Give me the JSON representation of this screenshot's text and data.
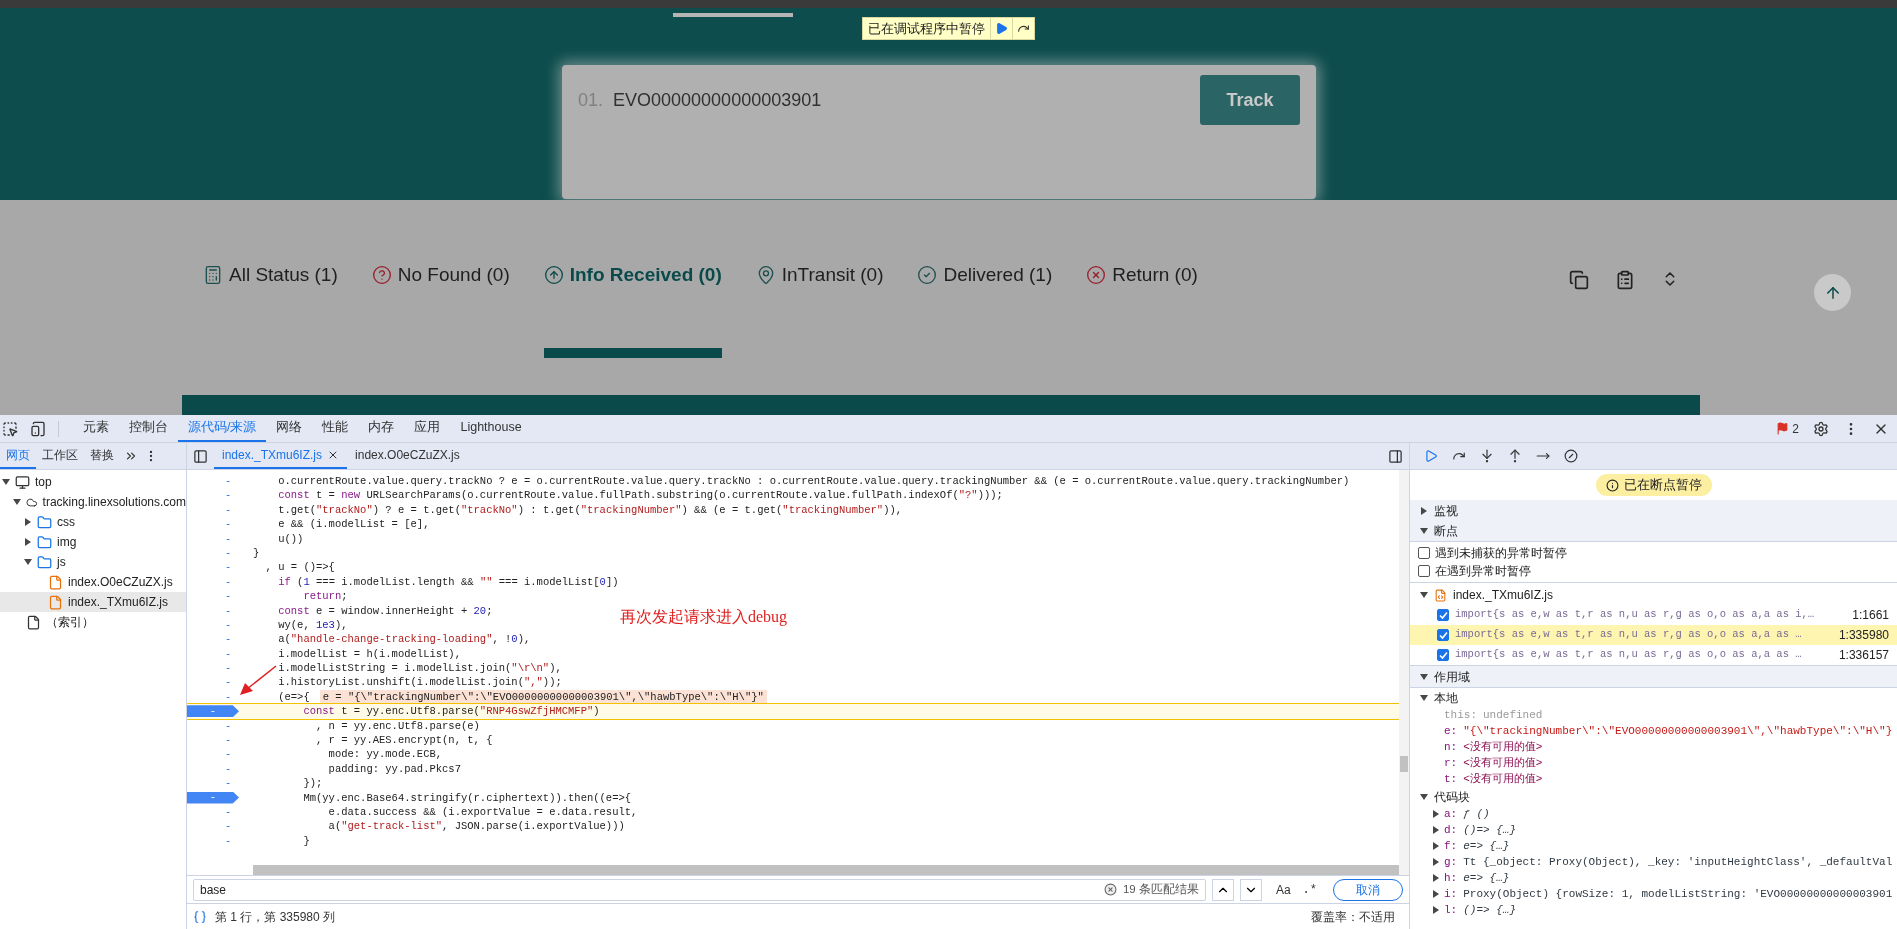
{
  "page": {
    "debugger_banner": {
      "text": "已在调试程序中暂停"
    },
    "search_card": {
      "index": "01.",
      "value": "EVO00000000000003901",
      "button": "Track"
    },
    "status_tabs": [
      {
        "kind": "all",
        "label": "All Status (1)",
        "selected": false
      },
      {
        "kind": "nofound",
        "label": "No Found (0)",
        "selected": false
      },
      {
        "kind": "received",
        "label": "Info Received (0)",
        "selected": true
      },
      {
        "kind": "transit",
        "label": "InTransit (0)",
        "selected": false
      },
      {
        "kind": "delivered",
        "label": "Delivered (1)",
        "selected": false
      },
      {
        "kind": "return",
        "label": "Return (0)",
        "selected": false
      }
    ]
  },
  "devtools": {
    "panel_tabs": [
      {
        "label": "元素",
        "selected": false
      },
      {
        "label": "控制台",
        "selected": false
      },
      {
        "label": "源代码/来源",
        "selected": true
      },
      {
        "label": "网络",
        "selected": false
      },
      {
        "label": "性能",
        "selected": false
      },
      {
        "label": "内存",
        "selected": false
      },
      {
        "label": "应用",
        "selected": false
      },
      {
        "label": "Lighthouse",
        "selected": false
      }
    ],
    "issues_count": "2",
    "navigator_tabs": [
      {
        "label": "网页",
        "selected": true
      },
      {
        "label": "工作区",
        "selected": false
      },
      {
        "label": "替换",
        "selected": false
      }
    ],
    "tree": [
      {
        "kind": "frame",
        "label": "top",
        "expanded": true,
        "selected": false,
        "children": [
          {
            "kind": "domain",
            "label": "tracking.linexsolutions.com",
            "expanded": true,
            "selected": false,
            "children": [
              {
                "kind": "folder",
                "label": "css",
                "expanded": false,
                "selected": false
              },
              {
                "kind": "folder",
                "label": "img",
                "expanded": false,
                "selected": false
              },
              {
                "kind": "folder",
                "label": "js",
                "expanded": true,
                "selected": false,
                "children": [
                  {
                    "kind": "file",
                    "label": "index.O0eCZuZX.js",
                    "selected": false
                  },
                  {
                    "kind": "file",
                    "label": "index._TXmu6IZ.js",
                    "selected": true
                  }
                ]
              }
            ]
          },
          {
            "kind": "page",
            "label": "（索引）",
            "selected": false
          }
        ]
      }
    ],
    "editor_tabs": [
      {
        "label": "index._TXmu6IZ.js",
        "selected": true
      },
      {
        "label": "index.O0eCZuZX.js",
        "selected": false
      }
    ],
    "code_lines": [
      {
        "breakpoint": false,
        "paused": false,
        "tokens": [
          {
            "kind": "plain",
            "text": "    o.currentRoute.value.query.trackNo ? e = o.currentRoute.value.query.trackNo : o.currentRoute.value.query.trackingNumber && (e = o.currentRoute.value.query.trackingNumber)"
          }
        ]
      },
      {
        "breakpoint": false,
        "paused": false,
        "tokens": [
          {
            "kind": "kw",
            "text": "    const"
          },
          {
            "kind": "plain",
            "text": " t = "
          },
          {
            "kind": "kw",
            "text": "new"
          },
          {
            "kind": "plain",
            "text": " URLSearchParams(o.currentRoute.value.fullPath.substring(o.currentRoute.value.fullPath.indexOf("
          },
          {
            "kind": "str",
            "text": "\"?\""
          },
          {
            "kind": "plain",
            "text": ")));"
          }
        ]
      },
      {
        "breakpoint": false,
        "paused": false,
        "tokens": [
          {
            "kind": "plain",
            "text": "    t.get("
          },
          {
            "kind": "str",
            "text": "\"trackNo\""
          },
          {
            "kind": "plain",
            "text": ") ? e = t.get("
          },
          {
            "kind": "str",
            "text": "\"trackNo\""
          },
          {
            "kind": "plain",
            "text": ") : t.get("
          },
          {
            "kind": "str",
            "text": "\"trackingNumber\""
          },
          {
            "kind": "plain",
            "text": ") && (e = t.get("
          },
          {
            "kind": "str",
            "text": "\"trackingNumber\""
          },
          {
            "kind": "plain",
            "text": ")),"
          }
        ]
      },
      {
        "breakpoint": false,
        "paused": false,
        "tokens": [
          {
            "kind": "plain",
            "text": "    e && (i.modelList = [e],"
          }
        ]
      },
      {
        "breakpoint": false,
        "paused": false,
        "tokens": [
          {
            "kind": "plain",
            "text": "    u())"
          }
        ]
      },
      {
        "breakpoint": false,
        "paused": false,
        "tokens": [
          {
            "kind": "plain",
            "text": "}"
          }
        ]
      },
      {
        "breakpoint": false,
        "paused": false,
        "tokens": [
          {
            "kind": "plain",
            "text": "  , u = ()=>{"
          }
        ]
      },
      {
        "breakpoint": false,
        "paused": false,
        "tokens": [
          {
            "kind": "kw",
            "text": "    if"
          },
          {
            "kind": "plain",
            "text": " ("
          },
          {
            "kind": "num",
            "text": "1"
          },
          {
            "kind": "plain",
            "text": " === i.modelList.length && "
          },
          {
            "kind": "str",
            "text": "\"\""
          },
          {
            "kind": "plain",
            "text": " === i.modelList["
          },
          {
            "kind": "num",
            "text": "0"
          },
          {
            "kind": "plain",
            "text": "])"
          }
        ]
      },
      {
        "breakpoint": false,
        "paused": false,
        "tokens": [
          {
            "kind": "kw",
            "text": "        return"
          },
          {
            "kind": "plain",
            "text": ";"
          }
        ]
      },
      {
        "breakpoint": false,
        "paused": false,
        "tokens": [
          {
            "kind": "kw",
            "text": "    const"
          },
          {
            "kind": "plain",
            "text": " e = window.innerHeight + "
          },
          {
            "kind": "num",
            "text": "20"
          },
          {
            "kind": "plain",
            "text": ";"
          }
        ]
      },
      {
        "breakpoint": false,
        "paused": false,
        "tokens": [
          {
            "kind": "plain",
            "text": "    wy(e, "
          },
          {
            "kind": "num",
            "text": "1e3"
          },
          {
            "kind": "plain",
            "text": "),"
          }
        ]
      },
      {
        "breakpoint": false,
        "paused": false,
        "tokens": [
          {
            "kind": "plain",
            "text": "    a("
          },
          {
            "kind": "str",
            "text": "\"handle-change-tracking-loading\""
          },
          {
            "kind": "plain",
            "text": ", !"
          },
          {
            "kind": "num",
            "text": "0"
          },
          {
            "kind": "plain",
            "text": "),"
          }
        ]
      },
      {
        "breakpoint": false,
        "paused": false,
        "tokens": [
          {
            "kind": "plain",
            "text": "    i.modelList = h(i.modelList),"
          }
        ]
      },
      {
        "breakpoint": false,
        "paused": false,
        "tokens": [
          {
            "kind": "plain",
            "text": "    i.modelListString = i.modelList.join("
          },
          {
            "kind": "str",
            "text": "\"\\r\\n\""
          },
          {
            "kind": "plain",
            "text": "),"
          }
        ]
      },
      {
        "breakpoint": false,
        "paused": false,
        "tokens": [
          {
            "kind": "plain",
            "text": "    i.historyList.unshift(i.modelList.join("
          },
          {
            "kind": "str",
            "text": "\",\""
          },
          {
            "kind": "plain",
            "text": "));"
          }
        ]
      },
      {
        "breakpoint": false,
        "paused": false,
        "tokens": [
          {
            "kind": "plain",
            "text": "    (e=>{"
          }
        ],
        "inline_value": "e = \"{\\\"trackingNumber\\\":\\\"EVO00000000000003901\\\",\\\"hawbType\\\":\\\"H\\\"}\""
      },
      {
        "breakpoint": true,
        "paused": true,
        "tokens": [
          {
            "kind": "kw",
            "text": "        const"
          },
          {
            "kind": "plain",
            "text": " t = yy.enc.Utf8.parse("
          },
          {
            "kind": "str",
            "text": "\"RNP4GswZfjHMCMFP\""
          },
          {
            "kind": "plain",
            "text": ")"
          }
        ]
      },
      {
        "breakpoint": false,
        "paused": false,
        "tokens": [
          {
            "kind": "plain",
            "text": "          , n = yy.enc.Utf8.parse(e)"
          }
        ]
      },
      {
        "breakpoint": false,
        "paused": false,
        "tokens": [
          {
            "kind": "plain",
            "text": "          , r = yy.AES.encrypt(n, t, {"
          }
        ]
      },
      {
        "breakpoint": false,
        "paused": false,
        "tokens": [
          {
            "kind": "plain",
            "text": "            mode: yy.mode.ECB,"
          }
        ]
      },
      {
        "breakpoint": false,
        "paused": false,
        "tokens": [
          {
            "kind": "plain",
            "text": "            padding: yy.pad.Pkcs7"
          }
        ]
      },
      {
        "breakpoint": false,
        "paused": false,
        "tokens": [
          {
            "kind": "plain",
            "text": "        });"
          }
        ]
      },
      {
        "breakpoint": true,
        "paused": false,
        "tokens": [
          {
            "kind": "plain",
            "text": "        Mm(yy.enc.Base64.stringify(r.ciphertext)).then((e=>{"
          }
        ]
      },
      {
        "breakpoint": false,
        "paused": false,
        "tokens": [
          {
            "kind": "plain",
            "text": "            e.data.success && (i.exportValue = e.data.result,"
          }
        ]
      },
      {
        "breakpoint": false,
        "paused": false,
        "tokens": [
          {
            "kind": "plain",
            "text": "            a("
          },
          {
            "kind": "str",
            "text": "\"get-track-list\""
          },
          {
            "kind": "plain",
            "text": ", JSON.parse(i.exportValue)))"
          }
        ]
      },
      {
        "breakpoint": false,
        "paused": false,
        "tokens": [
          {
            "kind": "plain",
            "text": "        }"
          }
        ]
      }
    ],
    "gutter_mark": "-",
    "annotation": "再次发起请求进入debug",
    "search": {
      "value": "base",
      "match_count": "19 条匹配结果",
      "case_button": "Aa",
      "regex_button": ".*",
      "cancel_button": "取消"
    },
    "status_bar": {
      "position": "第 1 行，第 335980 列",
      "coverage": "覆盖率：不适用"
    },
    "debugger": {
      "paused_badge": "已在断点暂停",
      "watch": {
        "label": "监视",
        "expanded": false
      },
      "breakpoints_section": {
        "label": "断点",
        "expanded": true
      },
      "exception_options": [
        {
          "label": "遇到未捕获的异常时暂停",
          "checked": false
        },
        {
          "label": "在遇到异常时暂停",
          "checked": false
        }
      ],
      "breakpoint_file": "index._TXmu6IZ.js",
      "breakpoints": [
        {
          "code": "import{s as e,w as t,r as n,u as r,g as o,o as a,a as i,…",
          "location": "1:1661",
          "checked": true,
          "selected": false
        },
        {
          "code": "import{s as e,w as t,r as n,u as r,g as o,o as a,a as …",
          "location": "1:335980",
          "checked": true,
          "selected": true
        },
        {
          "code": "import{s as e,w as t,r as n,u as r,g as o,o as a,a as …",
          "location": "1:336157",
          "checked": true,
          "selected": false
        }
      ],
      "scope_section": {
        "label": "作用域",
        "expanded": true
      },
      "local": {
        "label": "本地",
        "expanded": true,
        "vars": [
          {
            "name": "this:",
            "value": "undefined",
            "kind": "undefined"
          },
          {
            "name": "e:",
            "value": "\"{\\\"trackingNumber\\\":\\\"EVO00000000000003901\\\",\\\"hawbType\\\":\\\"H\\\"}",
            "kind": "string"
          },
          {
            "name": "n:",
            "value": "<没有可用的值>",
            "kind": "unavailable"
          },
          {
            "name": "r:",
            "value": "<没有可用的值>",
            "kind": "unavailable"
          },
          {
            "name": "t:",
            "value": "<没有可用的值>",
            "kind": "unavailable"
          }
        ]
      },
      "closure": {
        "label": "代码块",
        "expanded": true,
        "vars": [
          {
            "name": "a:",
            "value": "ƒ ()",
            "kind": "function"
          },
          {
            "name": "d:",
            "value": "()=> {…}",
            "kind": "function"
          },
          {
            "name": "f:",
            "value": "e=> {…}",
            "kind": "function"
          },
          {
            "name": "g:",
            "value": "Tt {_object: Proxy(Object), _key: 'inputHeightClass', _defaultVal",
            "kind": "object"
          },
          {
            "name": "h:",
            "value": "e=> {…}",
            "kind": "function"
          },
          {
            "name": "i:",
            "value": "Proxy(Object) {rowSize: 1, modelListString: 'EVO00000000000003901",
            "kind": "object"
          },
          {
            "name": "l:",
            "value": "()=> {…}",
            "kind": "function"
          }
        ]
      }
    }
  }
}
